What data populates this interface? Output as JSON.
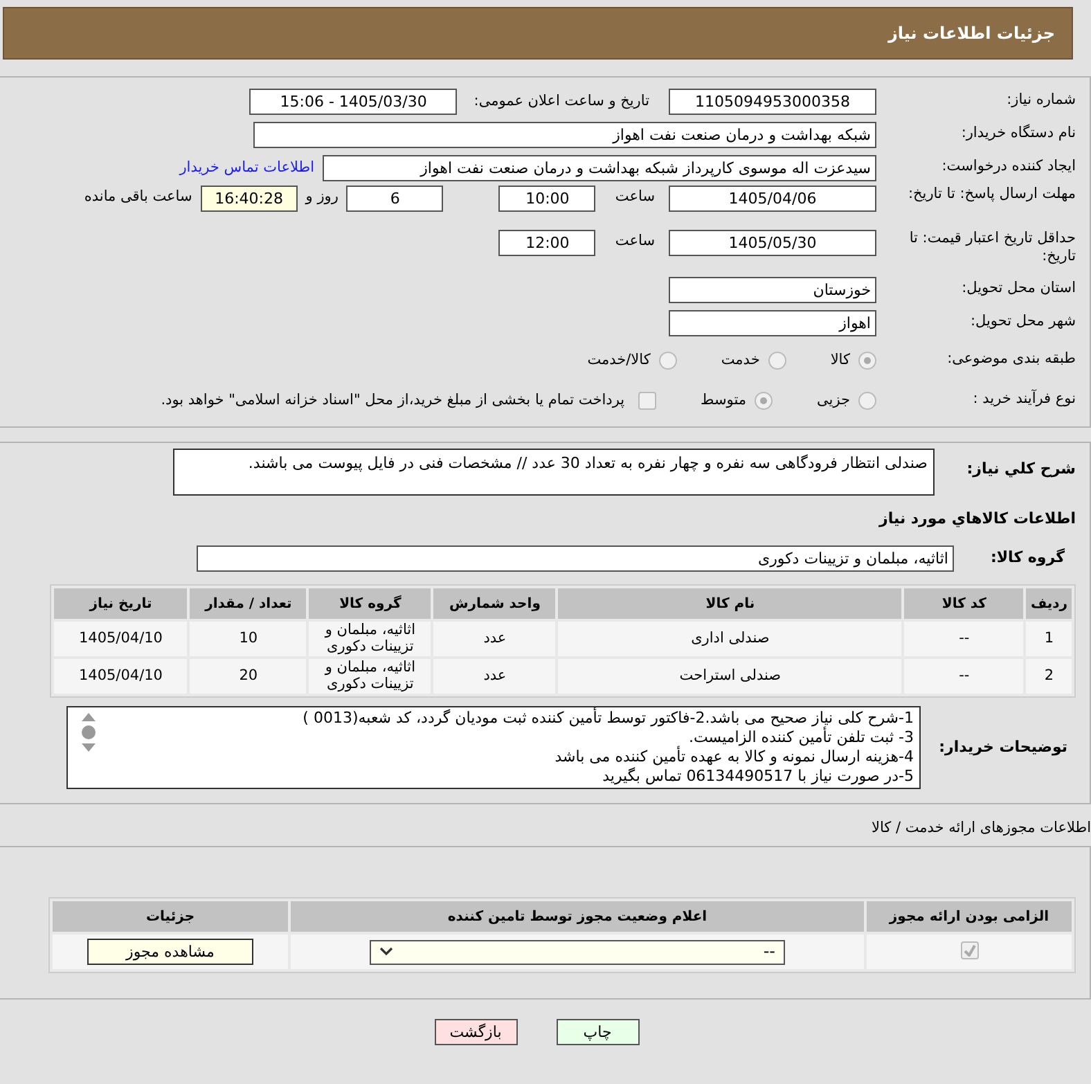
{
  "header": {
    "title": "جزئیات اطلاعات نیاز"
  },
  "need_number": {
    "label": "شماره نیاز:",
    "value": "1105094953000358"
  },
  "announce": {
    "label": "تاریخ و ساعت اعلان عمومی:",
    "value": "1405/03/30 - 15:06"
  },
  "buyer": {
    "label": "نام دستگاه خریدار:",
    "value": "شبکه بهداشت و درمان صنعت نفت اهواز"
  },
  "requester": {
    "label": "ایجاد کننده درخواست:",
    "value": "سیدعزت اله موسوی کارپرداز شبکه بهداشت و درمان صنعت نفت اهواز",
    "link": "اطلاعات تماس خریدار"
  },
  "deadline": {
    "label": "مهلت ارسال پاسخ: تا تاریخ:",
    "date": "1405/04/06",
    "time_label": "ساعت",
    "time": "10:00",
    "days": "6",
    "days_label": "روز و",
    "remaining": "16:40:28",
    "remaining_label": "ساعت باقی مانده"
  },
  "validity": {
    "label": "حداقل تاریخ اعتبار قیمت: تا تاریخ:",
    "date": "1405/05/30",
    "time_label": "ساعت",
    "time": "12:00"
  },
  "province": {
    "label": "استان محل تحویل:",
    "value": "خوزستان"
  },
  "city": {
    "label": "شهر محل تحویل:",
    "value": "اهواز"
  },
  "category": {
    "label": "طبقه بندی موضوعی:",
    "options": [
      {
        "label": "کالا",
        "selected": true
      },
      {
        "label": "خدمت",
        "selected": false
      },
      {
        "label": "کالا/خدمت",
        "selected": false
      }
    ]
  },
  "process": {
    "label": "نوع فرآیند خرید :",
    "options": [
      {
        "label": "جزیی",
        "selected": false
      },
      {
        "label": "متوسط",
        "selected": true
      }
    ],
    "payment": {
      "label": "پرداخت تمام یا بخشی از مبلغ خرید،از محل \"اسناد خزانه اسلامی\" خواهد بود.",
      "checked": false
    }
  },
  "description": {
    "label": "شرح کلي نياز:",
    "value": "صندلی انتظار فرودگاهی سه نفره و چهار نفره به تعداد 30 عدد // مشخصات فنی در فایل پیوست می باشند."
  },
  "goods_title": "اطلاعات کالاهاي مورد نياز",
  "goods_group": {
    "label": "گروه کالا:",
    "value": "اثاثیه، مبلمان و تزیینات دکوری"
  },
  "goods_table": {
    "columns": [
      "ردیف",
      "کد کالا",
      "نام کالا",
      "واحد شمارش",
      "گروه کالا",
      "تعداد / مقدار",
      "تاریخ نیاز"
    ],
    "rows": [
      [
        "1",
        "--",
        "صندلی اداری",
        "عدد",
        "اثاثیه، مبلمان و تزیینات دکوری",
        "10",
        "1405/04/10"
      ],
      [
        "2",
        "--",
        "صندلی استراحت",
        "عدد",
        "اثاثیه، مبلمان و تزیینات دکوری",
        "20",
        "1405/04/10"
      ]
    ]
  },
  "buyer_notes": {
    "label": "توضیحات خریدار:",
    "lines": [
      "1-شرح کلی نیاز صحیح می باشد.2-فاکتور توسط تأمین کننده ثبت مودیان گردد، کد شعبه(0013 )",
      " 3- ثبت تلفن تأمین کننده الزامیست.",
      "4-هزینه ارسال نمونه و کالا به عهده تأمین کننده می باشد",
      "5-در صورت نیاز با 06134490517 تماس بگیرید"
    ]
  },
  "permits": {
    "title": "اطلاعات مجوزهای ارائه خدمت / کالا",
    "columns": [
      "الزامی بودن ارائه مجوز",
      "اعلام وضعیت مجوز توسط تامین کننده",
      "جزئیات"
    ],
    "rows": [
      {
        "required": true,
        "status": "--",
        "button": "مشاهده مجوز"
      }
    ]
  },
  "buttons": [
    {
      "label": "چاپ",
      "kind": "print"
    },
    {
      "label": "بازگشت",
      "kind": "back"
    }
  ]
}
